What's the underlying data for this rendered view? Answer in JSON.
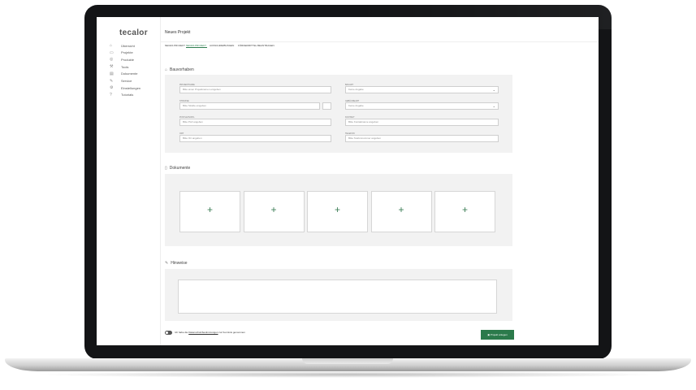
{
  "app": {
    "logo": "tecalor"
  },
  "sidebar": {
    "items": [
      {
        "icon": "home-icon",
        "glyph": "⌂",
        "label": "Übersicht"
      },
      {
        "icon": "folder-icon",
        "glyph": "▭",
        "label": "Projekte"
      },
      {
        "icon": "products-icon",
        "glyph": "◎",
        "label": "Produkte"
      },
      {
        "icon": "tools-icon",
        "glyph": "⚒",
        "label": "Tools"
      },
      {
        "icon": "documents-icon",
        "glyph": "▤",
        "label": "Dokumente"
      },
      {
        "icon": "service-icon",
        "glyph": "✎",
        "label": "Service"
      },
      {
        "icon": "settings-icon",
        "glyph": "⚙",
        "label": "Einstellungen"
      },
      {
        "icon": "help-icon",
        "glyph": "?",
        "label": "Tutorials"
      }
    ]
  },
  "header": {
    "title": "Neues Projekt"
  },
  "tabs": [
    {
      "label": "NEUES PROJEKT",
      "active": false
    },
    {
      "label": "NEUES PROJEKT",
      "active": true
    },
    {
      "label": "AUSSCHREIBUNGEN",
      "active": false
    },
    {
      "label": "FÖRDERMITTEL BEANTRAGEN",
      "active": false
    }
  ],
  "bauvorhaben": {
    "title": "Bauvorhaben",
    "fields": {
      "projektname": {
        "label": "PROJEKTNAME",
        "placeholder": "Bitte einen Projektnamen eingeben"
      },
      "strasse": {
        "label": "STRASSE",
        "placeholder": "Bitte Straße eingeben"
      },
      "postleitzahl": {
        "label": "POSTLEITZAHL",
        "placeholder": "Bitte PLZ angeben"
      },
      "ort": {
        "label": "ORT",
        "placeholder": "Bitte Ort angeben"
      },
      "bauart": {
        "label": "BAUART",
        "value": "Keine Angabe"
      },
      "gebaeude": {
        "label": "GEBÄUDEART",
        "value": "Keine Angabe"
      },
      "kontakt": {
        "label": "KONTAKT",
        "placeholder": "Bitte Kontaktname angeben"
      },
      "telefon": {
        "label": "TELEFON",
        "placeholder": "Bitte Telefonnummer angeben"
      }
    }
  },
  "dokumente": {
    "title": "Dokumente",
    "add_glyph": "+",
    "slots": 5
  },
  "hinweise": {
    "title": "Hinweise"
  },
  "footer": {
    "consent_prefix": "Ich habe die ",
    "consent_link": "Datenschutzbestimmungen",
    "consent_suffix": " zur Kenntnis genommen",
    "submit_label": "Projekt anlegen"
  }
}
